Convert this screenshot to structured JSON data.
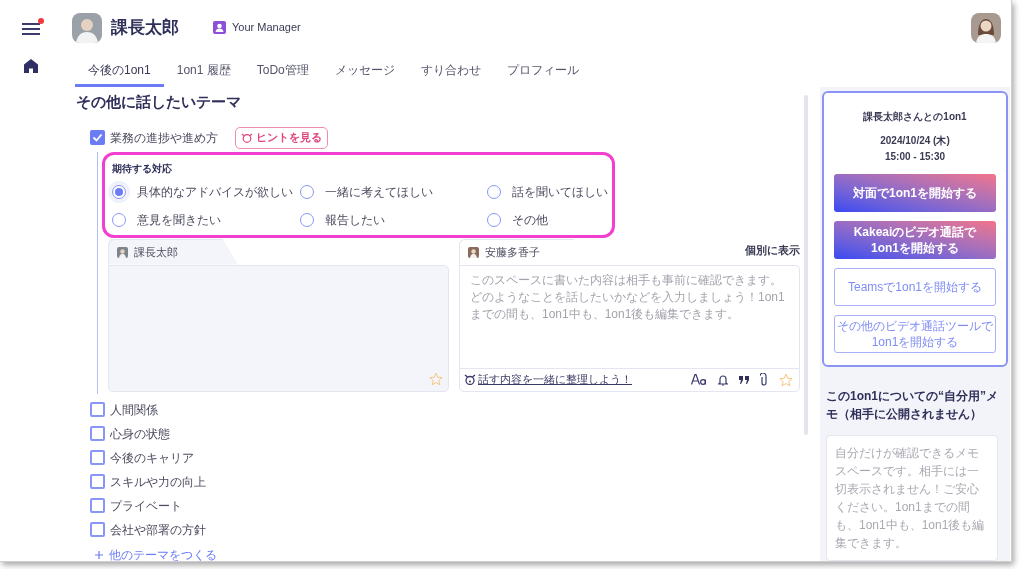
{
  "header": {
    "user_name": "課長太郎",
    "role_badge": "Your Manager",
    "menu_notification": true
  },
  "tabs": [
    {
      "label": "今後の1on1",
      "selected": true
    },
    {
      "label": "1on1 履歴",
      "selected": false
    },
    {
      "label": "ToDo管理",
      "selected": false
    },
    {
      "label": "メッセージ",
      "selected": false
    },
    {
      "label": "すり合わせ",
      "selected": false
    },
    {
      "label": "プロフィール",
      "selected": false
    }
  ],
  "section_title": "その他に話したいテーマ",
  "themes": [
    {
      "label": "業務の進捗や進め方",
      "checked": true,
      "hint_button": "ヒントを見る",
      "expected_response": {
        "title": "期待する対応",
        "options": [
          {
            "label": "具体的なアドバイスが欲しい",
            "selected": true
          },
          {
            "label": "一緒に考えてほしい",
            "selected": false
          },
          {
            "label": "話を聞いてほしい",
            "selected": false
          },
          {
            "label": "意見を聞きたい",
            "selected": false
          },
          {
            "label": "報告したい",
            "selected": false
          },
          {
            "label": "その他",
            "selected": false
          }
        ]
      },
      "notes": [
        {
          "author": "課長太郎"
        },
        {
          "author": "安藤多香子",
          "view_toggle": "個別に表示",
          "placeholder": "このスペースに書いた内容は相手も事前に確認できます。どのようなことを話したいかなどを入力しましょう！1on1までの間も、1on1中も、1on1後も編集できます。",
          "helper_link": "話す内容を一緒に整理しよう！"
        }
      ]
    },
    {
      "label": "人間関係",
      "checked": false
    },
    {
      "label": "心身の状態",
      "checked": false
    },
    {
      "label": "今後のキャリア",
      "checked": false
    },
    {
      "label": "スキルや力の向上",
      "checked": false
    },
    {
      "label": "プライベート",
      "checked": false
    },
    {
      "label": "会社や部署の方針",
      "checked": false
    }
  ],
  "add_theme": "他のテーマをつくる",
  "meeting": {
    "title": "課長太郎さんとの1on1",
    "date": "2024/10/24 (木)",
    "time": "15:00 - 15:30",
    "buttons": [
      {
        "label": "対面で1on1を開始する",
        "kind": "primary"
      },
      {
        "label": "Kakeaiのビデオ通話で\n1on1を開始する",
        "kind": "primary"
      },
      {
        "label": "Teamsで1on1を開始する",
        "kind": "outline"
      },
      {
        "label": "その他のビデオ通話ツールで\n1on1を開始する",
        "kind": "outline"
      }
    ]
  },
  "private_memo": {
    "title": "この1on1についての“自分用”メモ（相手に公開されません）",
    "placeholder": "自分だけが確認できるメモスペースです。相手には一切表示されません！ご安心ください。1on1までの間も、1on1中も、1on1後も編集できます。"
  }
}
